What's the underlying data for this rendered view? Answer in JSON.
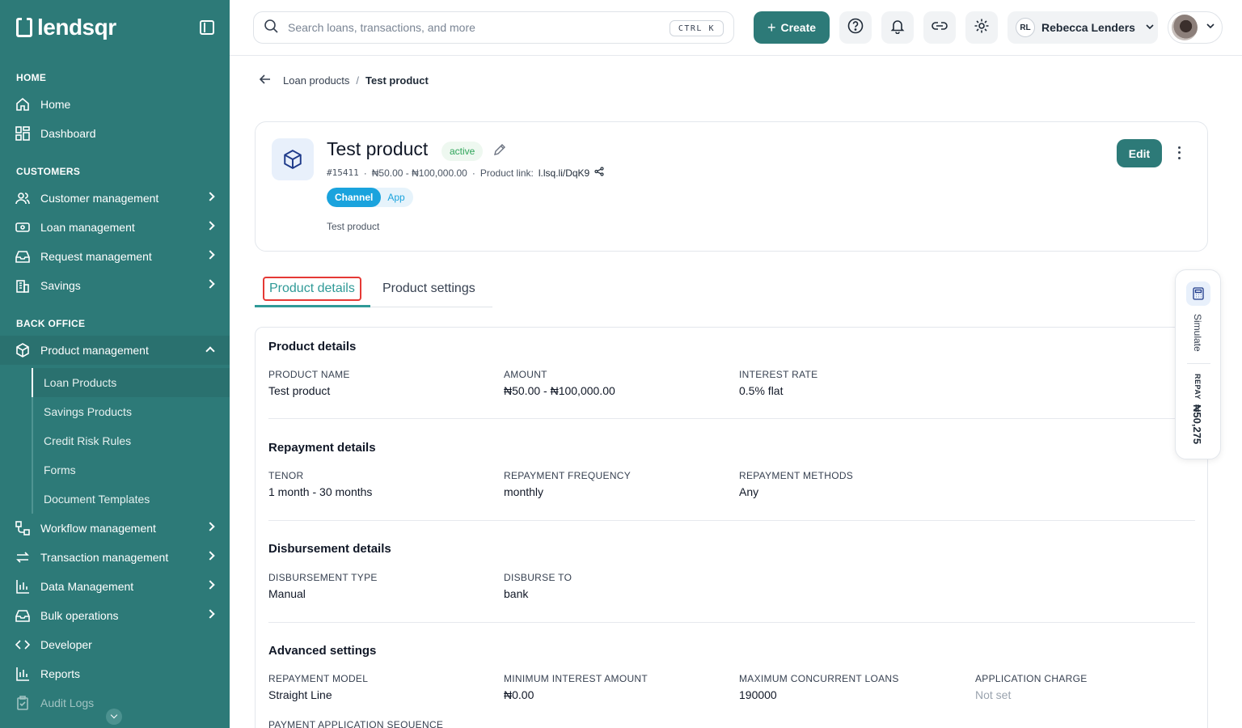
{
  "brand": {
    "name": "lendsqr"
  },
  "sidebar": {
    "sections": {
      "home": "HOME",
      "customers": "CUSTOMERS",
      "back_office": "BACK OFFICE"
    },
    "items": {
      "home": "Home",
      "dashboard": "Dashboard",
      "customer_management": "Customer management",
      "loan_management": "Loan management",
      "request_management": "Request management",
      "savings": "Savings",
      "product_management": "Product management",
      "workflow_management": "Workflow management",
      "transaction_management": "Transaction management",
      "data_management": "Data Management",
      "bulk_operations": "Bulk operations",
      "developer": "Developer",
      "reports": "Reports",
      "audit_logs": "Audit Logs"
    },
    "sub_items": [
      "Loan Products",
      "Savings Products",
      "Credit Risk Rules",
      "Forms",
      "Document Templates"
    ]
  },
  "topbar": {
    "search_placeholder": "Search loans, transactions, and more",
    "shortcut": "CTRL K",
    "create_label": "Create",
    "user_initials": "RL",
    "user_name": "Rebecca Lenders"
  },
  "breadcrumb": {
    "parent": "Loan products",
    "separator": "/",
    "current": "Test product"
  },
  "product": {
    "name": "Test product",
    "status": "active",
    "id": "#15411",
    "amount_range": "₦50.00 - ₦100,000.00",
    "link_label": "Product link:",
    "link": "l.lsq.li/DqK9",
    "tag_key": "Channel",
    "tag_value": "App",
    "description": "Test product",
    "edit_label": "Edit"
  },
  "tabs": [
    "Product details",
    "Product settings"
  ],
  "details": {
    "product": {
      "title": "Product details",
      "fields": [
        {
          "label": "PRODUCT NAME",
          "value": "Test product"
        },
        {
          "label": "AMOUNT",
          "value": "₦50.00 - ₦100,000.00"
        },
        {
          "label": "INTEREST RATE",
          "value": "0.5% flat"
        }
      ]
    },
    "repayment": {
      "title": "Repayment details",
      "fields": [
        {
          "label": "TENOR",
          "value": "1 month - 30 months"
        },
        {
          "label": "REPAYMENT FREQUENCY",
          "value": "monthly"
        },
        {
          "label": "REPAYMENT METHODS",
          "value": "Any"
        }
      ]
    },
    "disbursement": {
      "title": "Disbursement details",
      "fields": [
        {
          "label": "DISBURSEMENT TYPE",
          "value": "Manual"
        },
        {
          "label": "DISBURSE TO",
          "value": "bank"
        }
      ]
    },
    "advanced": {
      "title": "Advanced settings",
      "fields": [
        {
          "label": "REPAYMENT MODEL",
          "value": "Straight Line"
        },
        {
          "label": "MINIMUM INTEREST AMOUNT",
          "value": "₦0.00"
        },
        {
          "label": "MAXIMUM CONCURRENT LOANS",
          "value": "190000"
        },
        {
          "label": "APPLICATION CHARGE",
          "value": "Not set"
        }
      ],
      "partial_label": "PAYMENT APPLICATION SEQUENCE"
    }
  },
  "simulate": {
    "label": "Simulate",
    "repay_label": "REPAY",
    "repay_amount": "₦50,275"
  },
  "colors": {
    "brand": "#2d7a78",
    "accent": "#2f9a97",
    "active": "#2fa55a",
    "channel": "#1aa3dd",
    "highlight": "#e53935"
  }
}
